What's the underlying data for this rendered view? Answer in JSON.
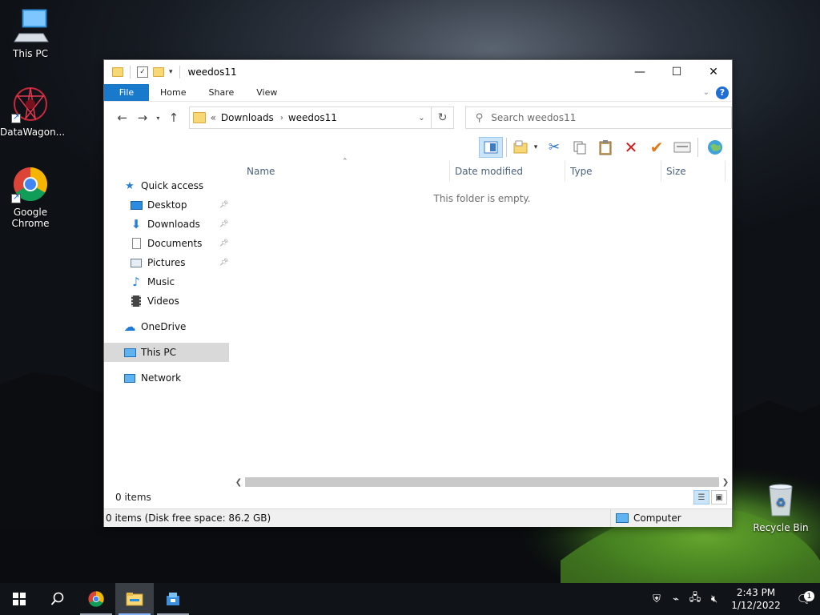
{
  "desktop": {
    "icons": [
      {
        "label": "This PC"
      },
      {
        "label": "DataWagon..."
      },
      {
        "label": "Google Chrome"
      },
      {
        "label": "Recycle Bin"
      }
    ]
  },
  "window": {
    "title": "weedos11",
    "controls": {
      "minimize": "—",
      "maximize": "☐",
      "close": "✕"
    },
    "ribbon": {
      "tabs": [
        {
          "label": "File"
        },
        {
          "label": "Home"
        },
        {
          "label": "Share"
        },
        {
          "label": "View"
        }
      ],
      "help": "?"
    },
    "address": {
      "prefix": "«",
      "segments": [
        "Downloads",
        "weedos11"
      ]
    },
    "search": {
      "placeholder": "Search weedos11"
    },
    "nav_pane": {
      "quick_access": "Quick access",
      "items": [
        {
          "label": "Desktop",
          "pinned": true
        },
        {
          "label": "Downloads",
          "pinned": true
        },
        {
          "label": "Documents",
          "pinned": true
        },
        {
          "label": "Pictures",
          "pinned": true
        },
        {
          "label": "Music",
          "pinned": false
        },
        {
          "label": "Videos",
          "pinned": false
        }
      ],
      "onedrive": "OneDrive",
      "this_pc": "This PC",
      "network": "Network"
    },
    "columns": [
      "Name",
      "Date modified",
      "Type",
      "Size"
    ],
    "empty_message": "This folder is empty.",
    "status": {
      "item_count": "0 items"
    },
    "details_bar": {
      "left": "0 items (Disk free space: 86.2 GB)",
      "right": "Computer"
    }
  },
  "taskbar": {
    "clock": {
      "time": "2:43 PM",
      "date": "1/12/2022"
    },
    "notification_count": "1"
  }
}
